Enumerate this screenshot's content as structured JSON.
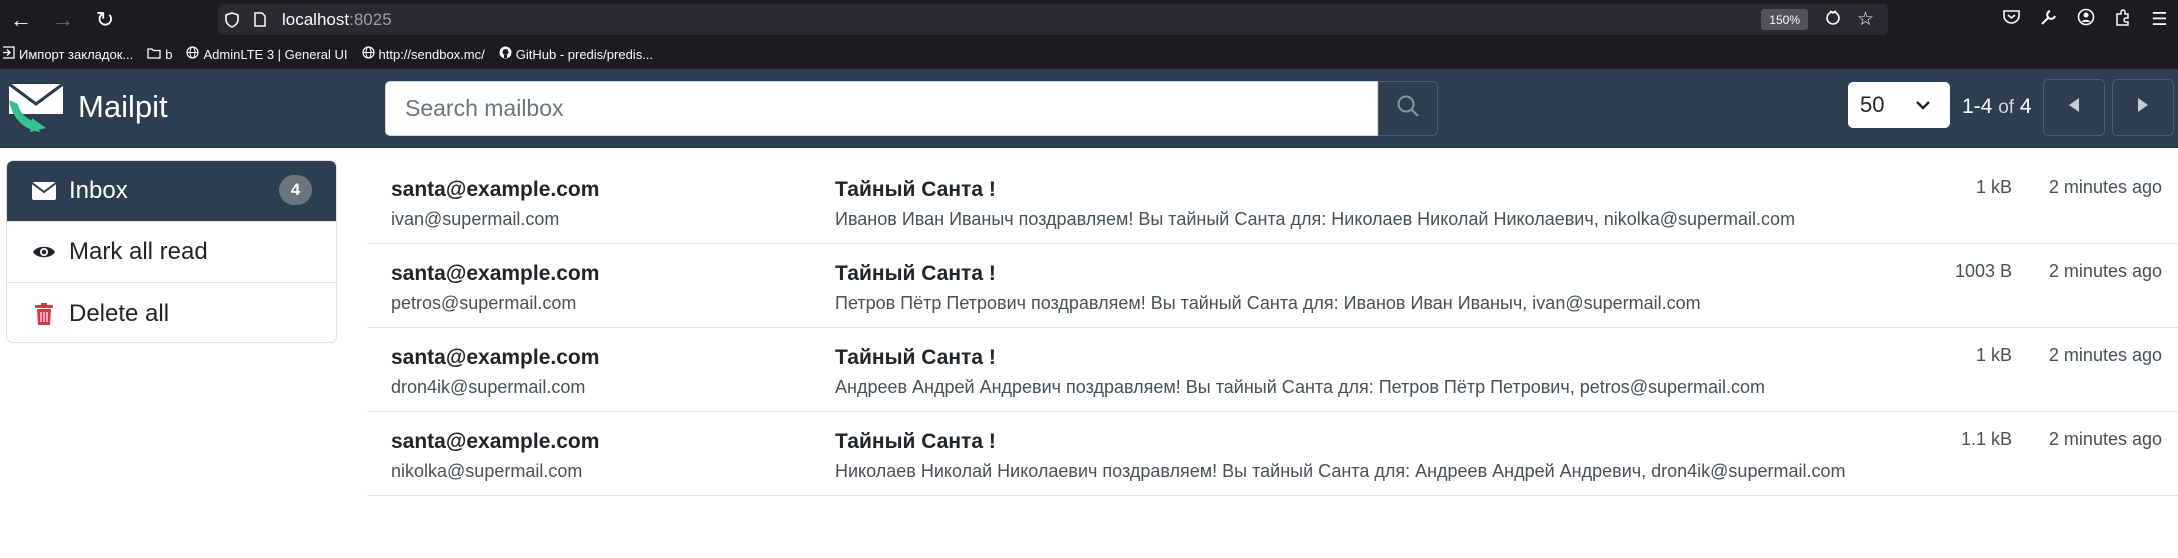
{
  "browser": {
    "url_host": "localhost",
    "url_port": ":8025",
    "zoom": "150%",
    "bookmarks": [
      {
        "label": "Импорт закладок...",
        "icon": "import-icon"
      },
      {
        "label": "b",
        "icon": "folder-icon"
      },
      {
        "label": "AdminLTE 3 | General UI",
        "icon": "globe-icon"
      },
      {
        "label": "http://sendbox.mc/",
        "icon": "globe-icon"
      },
      {
        "label": "GitHub - predis/predis...",
        "icon": "github-icon"
      }
    ]
  },
  "navbar": {
    "brand": "Mailpit",
    "search_placeholder": "Search mailbox",
    "per_page": "50",
    "page_range": "1-4",
    "page_of": "of",
    "page_total": "4"
  },
  "sidebar": {
    "items": [
      {
        "label": "Inbox",
        "icon": "envelope-icon",
        "badge": "4"
      },
      {
        "label": "Mark all read",
        "icon": "eye-icon"
      },
      {
        "label": "Delete all",
        "icon": "trash-icon"
      }
    ]
  },
  "messages": [
    {
      "from": "santa@example.com",
      "to": "ivan@supermail.com",
      "subject": "Тайный Санта !",
      "snippet": "Иванов Иван Иваныч поздравляем! Вы тайный Санта для: Николаев Николай Николаевич, nikolka@supermail.com",
      "size": "1 kB",
      "time": "2 minutes ago"
    },
    {
      "from": "santa@example.com",
      "to": "petros@supermail.com",
      "subject": "Тайный Санта !",
      "snippet": "Петров Пётр Петрович поздравляем! Вы тайный Санта для: Иванов Иван Иваныч, ivan@supermail.com",
      "size": "1003 B",
      "time": "2 minutes ago"
    },
    {
      "from": "santa@example.com",
      "to": "dron4ik@supermail.com",
      "subject": "Тайный Санта !",
      "snippet": "Андреев Андрей Андревич поздравляем! Вы тайный Санта для: Петров Пётр Петрович, petros@supermail.com",
      "size": "1 kB",
      "time": "2 minutes ago"
    },
    {
      "from": "santa@example.com",
      "to": "nikolka@supermail.com",
      "subject": "Тайный Санта !",
      "snippet": "Николаев Николай Николаевич поздравляем! Вы тайный Санта для: Андреев Андрей Андревич, dron4ik@supermail.com",
      "size": "1.1 kB",
      "time": "2 minutes ago"
    }
  ],
  "colors": {
    "navbar": "#2c3e50",
    "browser_chrome": "#1c1b22",
    "delete_icon": "#dc3545",
    "badge": "#6c757d"
  }
}
